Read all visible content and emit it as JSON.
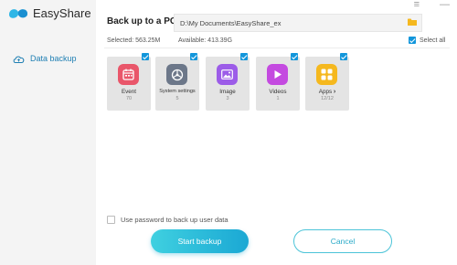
{
  "app": {
    "name": "EasyShare"
  },
  "sidebar": {
    "items": [
      {
        "label": "Data backup"
      }
    ]
  },
  "header": {
    "title": "Back up to a PC",
    "path": "D:\\My Documents\\EasyShare_ex",
    "selected": "Selected: 563.25M",
    "available": "Available: 413.39G",
    "select_all": "Select all"
  },
  "categories": [
    {
      "name": "Event",
      "count": "70",
      "color": "#e9566a"
    },
    {
      "name": "System settings",
      "count": "5",
      "color": "#6c7789"
    },
    {
      "name": "Image",
      "count": "3",
      "color": "#9c5ce8"
    },
    {
      "name": "Videos",
      "count": "1",
      "color": "#c44ae0"
    },
    {
      "name": "Apps",
      "count": "12/12",
      "color": "#f5b81e"
    }
  ],
  "password_option": "Use password to back up user data",
  "buttons": {
    "start": "Start backup",
    "cancel": "Cancel"
  },
  "colors": {
    "accent": "#1296db",
    "primary_button": "#2bbbdc"
  }
}
